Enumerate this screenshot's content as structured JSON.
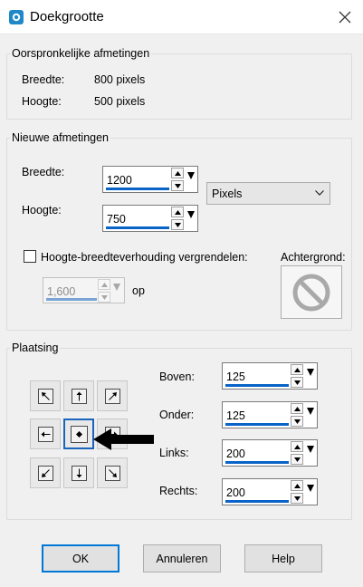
{
  "window": {
    "title": "Doekgrootte"
  },
  "original": {
    "legend": "Oorspronkelijke afmetingen",
    "width_label": "Breedte:",
    "width_value": "800 pixels",
    "height_label": "Hoogte:",
    "height_value": "500 pixels"
  },
  "new_dims": {
    "legend": "Nieuwe afmetingen",
    "width_label": "Breedte:",
    "width_value": "1200",
    "height_label": "Hoogte:",
    "height_value": "750",
    "unit_selected": "Pixels",
    "lock_label": "Hoogte-breedteverhouding vergrendelen:",
    "lock_checked": false,
    "ratio_value": "1,600",
    "ratio_suffix": "op",
    "background_label": "Achtergrond:"
  },
  "placement": {
    "legend": "Plaatsing",
    "top_label": "Boven:",
    "top_value": "125",
    "bottom_label": "Onder:",
    "bottom_value": "125",
    "left_label": "Links:",
    "left_value": "200",
    "right_label": "Rechts:",
    "right_value": "200",
    "anchor_selected": "center"
  },
  "buttons": {
    "ok": "OK",
    "cancel": "Annuleren",
    "help": "Help"
  },
  "colors": {
    "accent": "#0078d7",
    "underline": "#0a64c8",
    "app_icon": "#1e88c8"
  }
}
